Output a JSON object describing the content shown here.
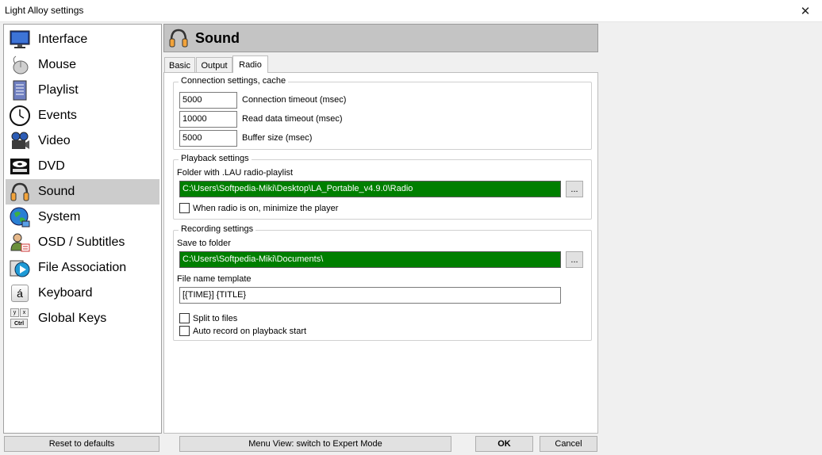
{
  "window": {
    "title": "Light Alloy settings",
    "close_glyph": "✕"
  },
  "sidebar": {
    "items": [
      {
        "label": "Interface",
        "icon": "monitor-icon"
      },
      {
        "label": "Mouse",
        "icon": "mouse-icon"
      },
      {
        "label": "Playlist",
        "icon": "playlist-icon"
      },
      {
        "label": "Events",
        "icon": "clock-icon"
      },
      {
        "label": "Video",
        "icon": "camera-icon"
      },
      {
        "label": "DVD",
        "icon": "dvd-icon"
      },
      {
        "label": "Sound",
        "icon": "headphones-icon"
      },
      {
        "label": "System",
        "icon": "globe-icon"
      },
      {
        "label": "OSD / Subtitles",
        "icon": "subtitles-icon"
      },
      {
        "label": "File Association",
        "icon": "file-association-icon"
      },
      {
        "label": "Keyboard",
        "icon": "keyboard-icon"
      },
      {
        "label": "Global Keys",
        "icon": "global-keys-icon"
      }
    ],
    "active_index": 6,
    "keyboard_icon_glyph": "á",
    "global_keys_glyphs": [
      "y",
      "x",
      "Ctrl"
    ]
  },
  "header": {
    "title": "Sound",
    "icon": "headphones-icon"
  },
  "tabs": [
    {
      "label": "Basic"
    },
    {
      "label": "Output"
    },
    {
      "label": "Radio"
    }
  ],
  "active_tab": "Radio",
  "connection": {
    "legend": "Connection settings, cache",
    "fields": [
      {
        "value": "5000",
        "label": "Connection timeout (msec)"
      },
      {
        "value": "10000",
        "label": "Read data timeout (msec)"
      },
      {
        "value": "5000",
        "label": "Buffer size (msec)"
      }
    ]
  },
  "playback": {
    "legend": "Playback settings",
    "folder_label": "Folder with .LAU radio-playlist",
    "folder_value": "C:\\Users\\Softpedia-Miki\\Desktop\\LA_Portable_v4.9.0\\Radio",
    "browse_label": "...",
    "minimize_label": "When radio is on, minimize the player"
  },
  "recording": {
    "legend": "Recording settings",
    "save_label": "Save to folder",
    "save_value": "C:\\Users\\Softpedia-Miki\\Documents\\",
    "browse_label": "...",
    "template_label": "File name template",
    "template_value": "[{TIME}] {TITLE}",
    "split_label": "Split to files",
    "auto_record_label": "Auto record on playback start"
  },
  "buttons": {
    "reset": "Reset to defaults",
    "menu_view": "Menu View: switch to Expert Mode",
    "ok": "OK",
    "cancel": "Cancel"
  },
  "colors": {
    "path_field_bg": "#007f00",
    "active_item_bg": "#cccccc",
    "header_bg": "#c4c4c4"
  }
}
